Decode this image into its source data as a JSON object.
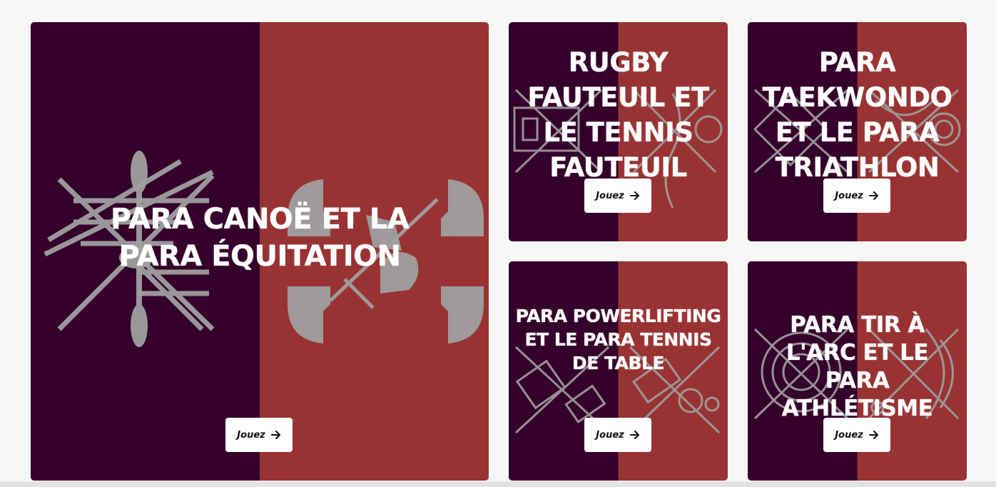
{
  "cards": [
    {
      "title": "PARA CANOË ET LA PARA ÉQUITATION",
      "button": "Jouez",
      "icon": "arrow-right-icon"
    },
    {
      "title": "RUGBY FAUTEUIL ET LE TENNIS FAUTEUIL",
      "button": "Jouez",
      "icon": "arrow-right-icon"
    },
    {
      "title": "PARA TAEKWONDO ET LE PARA TRIATHLON",
      "button": "Jouez",
      "icon": "arrow-right-icon"
    },
    {
      "title": "PARA POWERLIFTING ET LE PARA TENNIS DE TABLE",
      "button": "Jouez",
      "icon": "arrow-right-icon"
    },
    {
      "title": "PARA TIR À L'ARC ET LE PARA ATHLÉTISME",
      "button": "Jouez",
      "icon": "arrow-right-icon"
    }
  ],
  "colors": {
    "left_panel": "#34002b",
    "right_panel": "#993333",
    "illustration": "#a0a0a0",
    "button_bg": "#ffffff",
    "page_bg": "#f7f7f7"
  }
}
